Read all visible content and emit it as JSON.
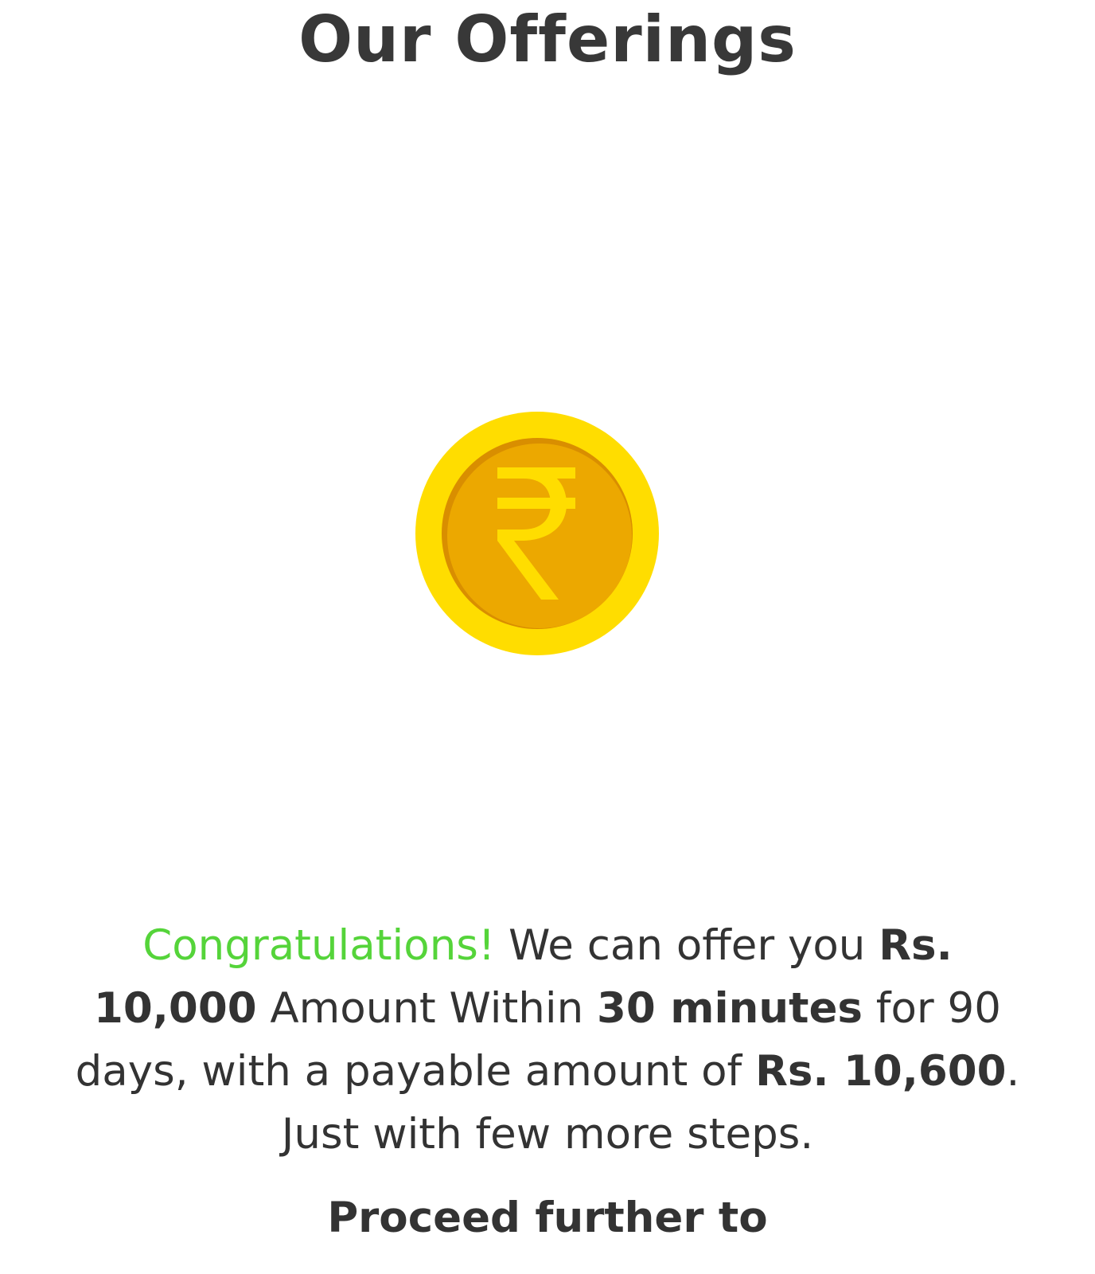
{
  "header": {
    "title": "Our Offerings"
  },
  "coin": {
    "icon": "rupee-coin-icon",
    "symbol": "₹",
    "colors": {
      "outer_ring": "#FFDD00",
      "inner_face": "#ECA800",
      "inner_shadow": "#D98E00",
      "symbol": "#FFDD00"
    }
  },
  "offer": {
    "congrats": "Congratulations!",
    "text1": " We can offer you ",
    "amount": "Rs. 10,000",
    "text2": " Amount Within ",
    "duration": "30 minutes",
    "text3": " for 90 days, with a payable amount of ",
    "payable": "Rs. 10,600",
    "text4": ". Just with few more steps."
  },
  "cta": {
    "label": "Proceed further to"
  },
  "colors": {
    "accent_green": "#55D43A",
    "text": "#333333"
  }
}
